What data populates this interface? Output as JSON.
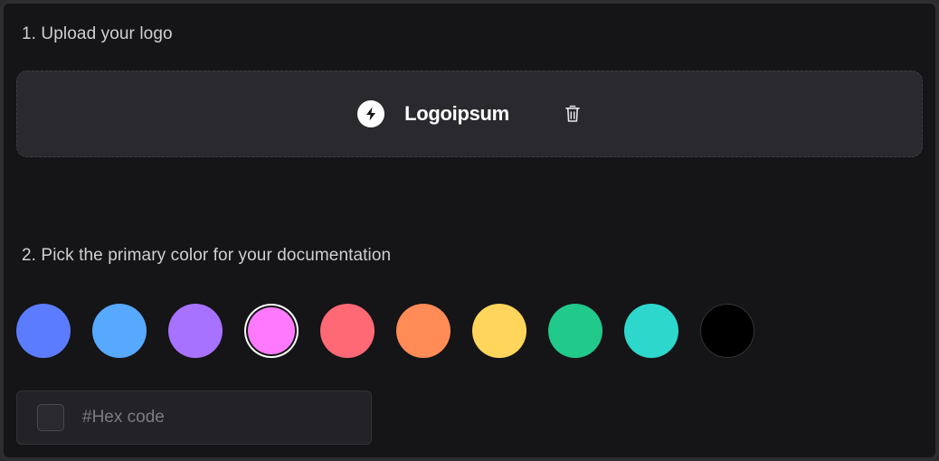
{
  "step1": {
    "label": "1. Upload your logo"
  },
  "logo": {
    "name": "Logoipsum",
    "mark_icon": "bolt-icon"
  },
  "delete_icon": "trash-icon",
  "step2": {
    "label": "2. Pick the primary color for your documentation"
  },
  "colors": {
    "options": [
      "#5b7cff",
      "#57a8ff",
      "#a672ff",
      "#ff79ff",
      "#ff6875",
      "#ff8b57",
      "#ffd55b",
      "#21c98a",
      "#2ed7cc",
      "#000000"
    ],
    "selected_index": 3
  },
  "hex": {
    "placeholder": "#Hex code",
    "value": ""
  }
}
